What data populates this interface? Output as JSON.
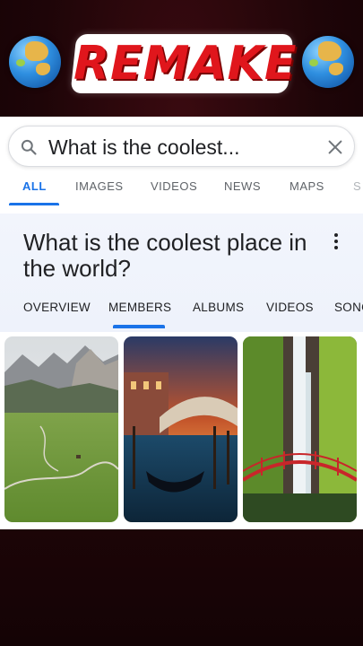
{
  "banner": {
    "title": "REMAKE",
    "left_icon": "globe-asia-icon",
    "right_icon": "globe-asia-icon"
  },
  "search": {
    "query": "What is the coolest...",
    "icon": "search-icon",
    "clear_icon": "close-icon"
  },
  "search_tabs": [
    {
      "label": "ALL",
      "active": true
    },
    {
      "label": "IMAGES",
      "active": false
    },
    {
      "label": "VIDEOS",
      "active": false
    },
    {
      "label": "NEWS",
      "active": false
    },
    {
      "label": "MAPS",
      "active": false
    },
    {
      "label": "S",
      "active": false
    }
  ],
  "knowledge_panel": {
    "title": "What is the coolest place in the world?",
    "tabs": [
      {
        "label": "OVERVIEW",
        "active": false
      },
      {
        "label": "MEMBERS",
        "active": true
      },
      {
        "label": "ALBUMS",
        "active": false
      },
      {
        "label": "VIDEOS",
        "active": false
      },
      {
        "label": "SONG",
        "active": false
      }
    ]
  },
  "colors": {
    "accent": "#1a73e8",
    "banner_red": "#e0161c",
    "background_dark": "#1e0508"
  },
  "images": [
    {
      "name": "mountain-valley-image"
    },
    {
      "name": "venice-canal-image"
    },
    {
      "name": "waterfall-bridge-image"
    }
  ]
}
